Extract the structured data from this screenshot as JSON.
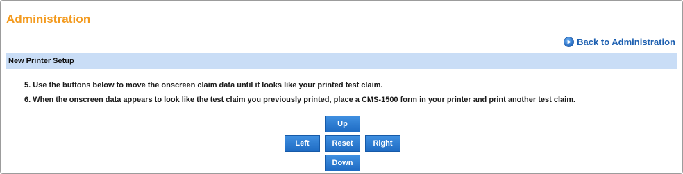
{
  "page": {
    "title": "Administration"
  },
  "back_link": {
    "label": "Back to Administration",
    "icon": "arrow-right-circle-icon"
  },
  "section": {
    "title": "New Printer Setup"
  },
  "instructions": [
    "5. Use the buttons below to move the onscreen claim data until it looks like your printed test claim.",
    "6. When the onscreen data appears to look like the test claim you previously printed, place a CMS-1500 form in your printer and print another test claim."
  ],
  "controls": {
    "up": "Up",
    "left": "Left",
    "reset": "Reset",
    "right": "Right",
    "down": "Down"
  },
  "colors": {
    "title": "#f39a1e",
    "link": "#1c5fb0",
    "section_bar": "#c9ddf6",
    "button": "#2a7ad4"
  }
}
